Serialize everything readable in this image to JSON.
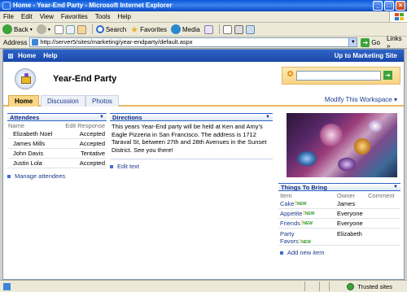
{
  "window": {
    "title": "Home - Year-End Party - Microsoft Internet Explorer"
  },
  "menu": [
    "File",
    "Edit",
    "View",
    "Favorites",
    "Tools",
    "Help"
  ],
  "toolbar": {
    "back": "Back",
    "search": "Search",
    "favorites": "Favorites",
    "media": "Media"
  },
  "address": {
    "label": "Address",
    "url": "http://server5/sites/marketing/year-endparty/default.aspx",
    "go": "Go",
    "links": "Links »"
  },
  "topnav": {
    "home": "Home",
    "help": "Help",
    "up": "Up to Marketing Site"
  },
  "site": {
    "title": "Year-End Party"
  },
  "tabs": [
    "Home",
    "Discussion",
    "Photos"
  ],
  "modify": "Modify This Workspace ▾",
  "attendees": {
    "title": "Attendees",
    "col_name": "Name",
    "col_response": "Edit Response",
    "rows": [
      {
        "name": "Elizabeth Noel",
        "response": "Accepted"
      },
      {
        "name": "James Mills",
        "response": "Accepted"
      },
      {
        "name": "John Davis",
        "response": "Tentative"
      },
      {
        "name": "Justin Lola",
        "response": "Accepted"
      }
    ],
    "manage": "Manage attendees"
  },
  "directions": {
    "title": "Directions",
    "text": "This years Year-End party will be held at Ken and Amy's Eagle Pizzeria in San Francisco.  The address is 1712 Taraval St, between 27th and 28th Avenues in the Sunset District.  See you there!",
    "edit": "Edit text"
  },
  "things": {
    "title": "Things To Bring",
    "col_item": "Item",
    "col_owner": "Owner",
    "col_comment": "Comment",
    "new_label": "NEW",
    "rows": [
      {
        "item": "Cake",
        "owner": "James"
      },
      {
        "item": "Appetite",
        "owner": "Everyone"
      },
      {
        "item": "Friends",
        "owner": "Everyone"
      },
      {
        "item_line1": "Party",
        "item_line2": "Favors",
        "owner": "Elizabeth"
      }
    ],
    "add": "Add new item"
  },
  "status": {
    "zone": "Trusted sites"
  }
}
